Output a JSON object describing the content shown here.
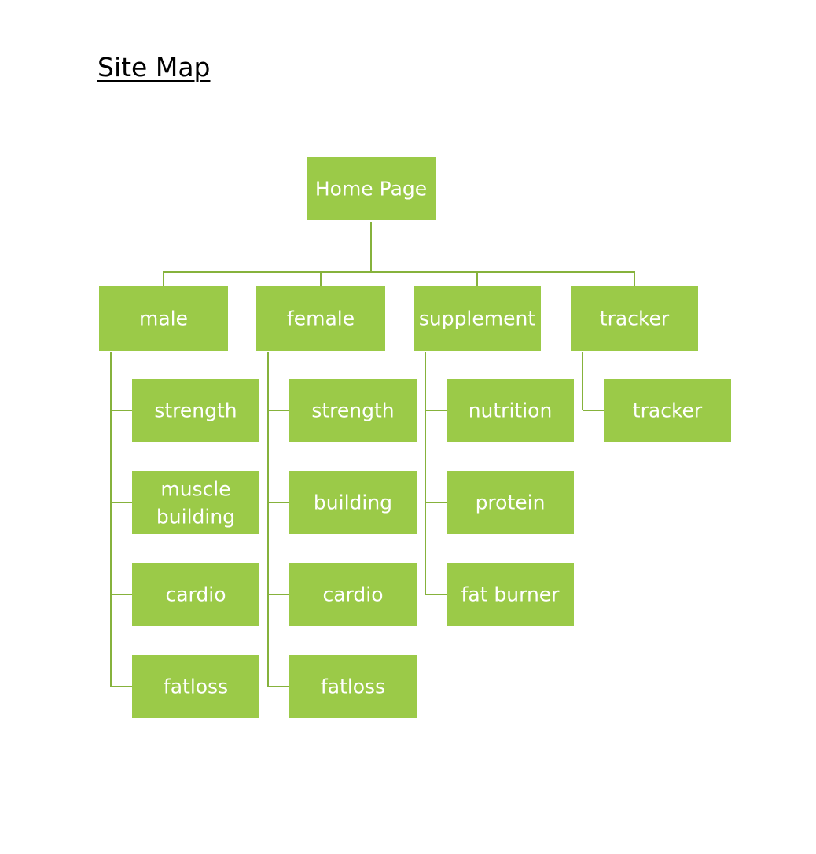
{
  "title": "Site Map",
  "colors": {
    "node_fill": "#9bca48",
    "node_text": "#ffffff",
    "connector": "#86b23c",
    "title_text": "#000000",
    "background": "#ffffff"
  },
  "root": {
    "label": "Home Page"
  },
  "branches": [
    {
      "id": "male",
      "label": "male",
      "children": [
        "strength",
        "muscle building",
        "cardio",
        "fatloss"
      ]
    },
    {
      "id": "female",
      "label": "female",
      "children": [
        "strength",
        "building",
        "cardio",
        "fatloss"
      ]
    },
    {
      "id": "supplement",
      "label": "supplement",
      "children": [
        "nutrition",
        "protein",
        "fat burner"
      ]
    },
    {
      "id": "tracker",
      "label": "tracker",
      "children": [
        "tracker"
      ]
    }
  ]
}
